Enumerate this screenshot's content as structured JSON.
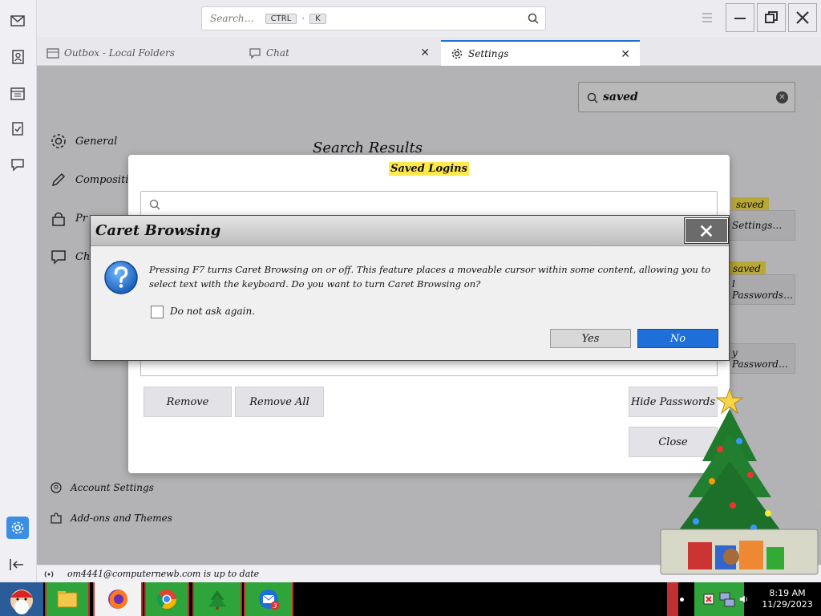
{
  "titlebar": {
    "search_placeholder": "Search…",
    "shortcut_ctrl": "CTRL",
    "shortcut_key": "K"
  },
  "tabs": [
    {
      "label": "Outbox - Local Folders"
    },
    {
      "label": "Chat"
    },
    {
      "label": "Settings"
    }
  ],
  "settings_nav": {
    "items": [
      {
        "label": "General"
      },
      {
        "label": "Composition"
      },
      {
        "label": "Pr"
      },
      {
        "label": "Ch"
      }
    ],
    "account_settings": "Account Settings",
    "addons_themes": "Add-ons and Themes"
  },
  "settings_search": {
    "value": "saved"
  },
  "search_results": {
    "heading": "Search Results",
    "highlights": [
      "saved",
      "saved"
    ],
    "buttons": [
      "Settings…",
      "l Passwords…",
      "y Password…"
    ]
  },
  "saved_logins_dialog": {
    "title": "Saved Logins",
    "remove": "Remove",
    "remove_all": "Remove All",
    "hide_passwords": "Hide Passwords",
    "close": "Close"
  },
  "caret_dialog": {
    "title": "Caret Browsing",
    "message": "Pressing F7 turns Caret Browsing on or off. This feature places a moveable cursor within some content, allowing you to select text with the keyboard. Do you want to turn Caret Browsing on?",
    "checkbox_label": "Do not ask again.",
    "yes": "Yes",
    "no": "No"
  },
  "statusbar": {
    "text": "om4441@computernewb.com is up to date"
  },
  "taskbar": {
    "time": "8:19 AM",
    "date": "11/29/2023",
    "thunderbird_badge": "3"
  },
  "colors": {
    "accent_blue": "#1f6fd8",
    "highlight_yellow": "#ffe94d",
    "taskbar_green": "#2ea43a"
  }
}
